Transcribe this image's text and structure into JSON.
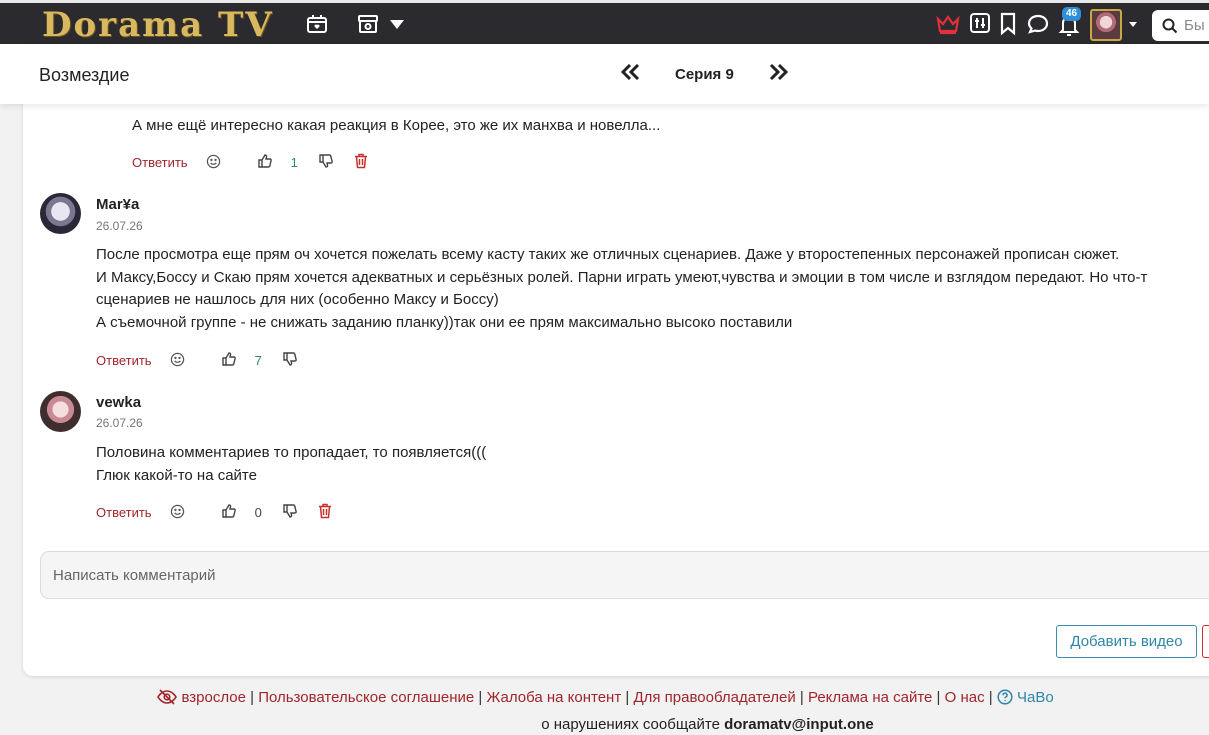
{
  "app": {
    "logo": "Dorama TV"
  },
  "topbar": {
    "notifications_count": "46",
    "search_placeholder": "Бы"
  },
  "subheader": {
    "title": "Возмездие",
    "episode_label": "Серия 9"
  },
  "comments": [
    {
      "text": "А мне ещё интересно какая реакция в Корее, это же их манхва и новелла...",
      "reply_label": "Ответить",
      "likes": "1"
    },
    {
      "author": "Mar¥a",
      "date": "26.07.26",
      "lines": [
        "После просмотра еще прям оч хочется пожелать всему касту таких же отличных сценариев. Даже у второстепенных персонажей прописан сюжет.",
        "И Максу,Боссу и Скаю прям хочется адекватных и серьёзных ролей. Парни играть умеют,чувства и эмоции в том числе и взглядом передают. Но что-т",
        "сценариев не нашлось для них (особенно Максу и Боссу)",
        "А съемочной группе - не снижать заданию планку))так они ее прям максимально высоко поставили"
      ],
      "reply_label": "Ответить",
      "likes": "7"
    },
    {
      "author": "vewka",
      "date": "26.07.26",
      "lines": [
        "Половина комментариев то пропадает, то появляется(((",
        "Глюк какой-то на сайте"
      ],
      "reply_label": "Ответить",
      "likes": "0"
    }
  ],
  "compose": {
    "placeholder": "Написать комментарий"
  },
  "buttons": {
    "add_video": "Добавить видео"
  },
  "footer": {
    "adult": "взрослое",
    "agreement": "Пользовательское соглашение",
    "complaint": "Жалоба на контент",
    "rightholders": "Для правообладателей",
    "ads": "Реклама на сайте",
    "about": "О нас",
    "faq": "ЧаВо",
    "report_text": "о нарушениях сообщайте",
    "email": "doramatv@input.one"
  },
  "colors": {
    "accent_red": "#a0262a",
    "like_green": "#2e8b57",
    "header_bg": "#2b2b2f",
    "logo_gold": "#d9b860"
  }
}
